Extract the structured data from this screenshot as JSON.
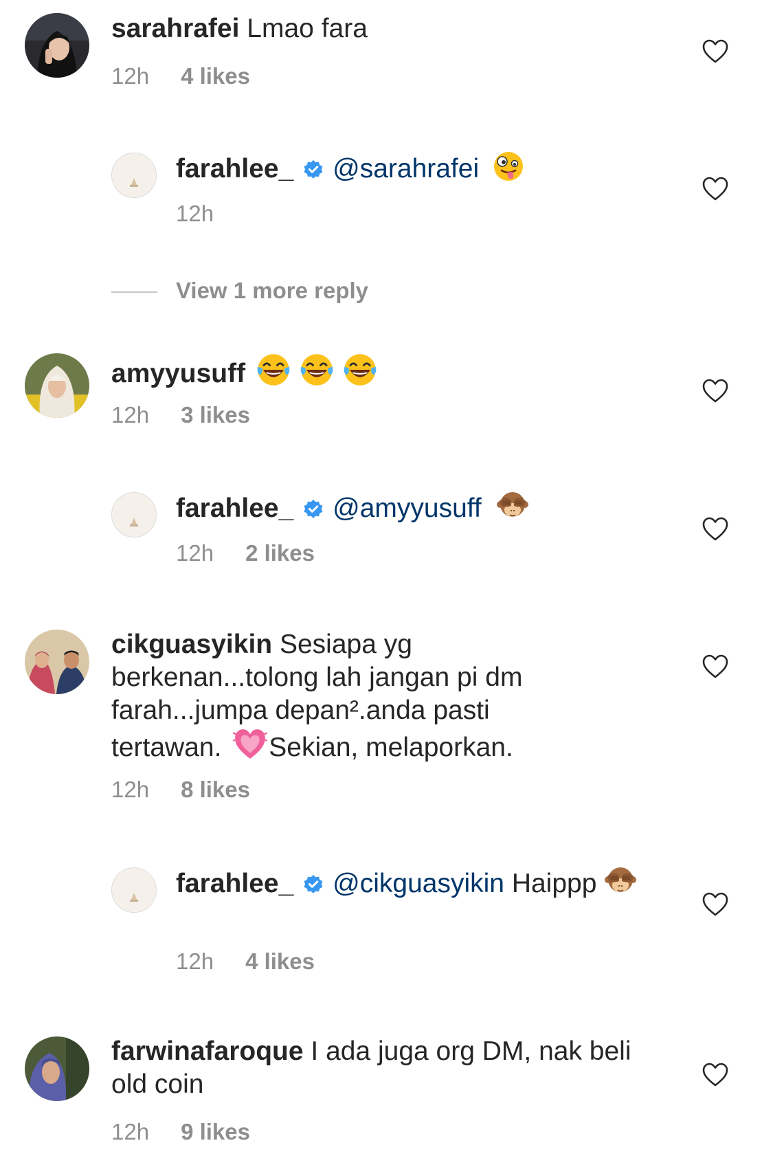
{
  "comments": [
    {
      "user": "sarahrafei",
      "text": "Lmao fara",
      "time": "12h",
      "likes": "4 likes"
    },
    {
      "user": "farahlee_",
      "mention": "@sarahrafei",
      "time": "12h",
      "likes": ""
    },
    {
      "user": "amyyusuff",
      "text": "",
      "time": "12h",
      "likes": "3 likes"
    },
    {
      "user": "farahlee_",
      "mention": "@amyyusuff",
      "time": "12h",
      "likes": "2 likes"
    },
    {
      "user": "cikguasyikin",
      "text": "Sesiapa yg berkenan...tolong lah jangan pi dm farah...jumpa depan².anda pasti tertawan.",
      "text2": "Sekian, melaporkan.",
      "time": "12h",
      "likes": "8 likes"
    },
    {
      "user": "farahlee_",
      "mention": "@cikguasyikin",
      "text": "Haippp",
      "time": "12h",
      "likes": "4 likes"
    },
    {
      "user": "farwinafaroque",
      "text": "I ada juga org DM, nak beli old coin",
      "time": "12h",
      "likes": "9 likes"
    }
  ],
  "view_more": "View 1 more reply",
  "icons": {
    "heart": "heart-outline-icon",
    "verified": "verified-badge-icon",
    "zany": "zany-face-emoji",
    "laugh": "tears-of-joy-emoji",
    "monkey": "see-no-evil-monkey-emoji",
    "heart_pink": "growing-heart-emoji"
  },
  "colors": {
    "mention": "#003569",
    "meta": "#8e8e8e",
    "verified": "#3897f0"
  }
}
